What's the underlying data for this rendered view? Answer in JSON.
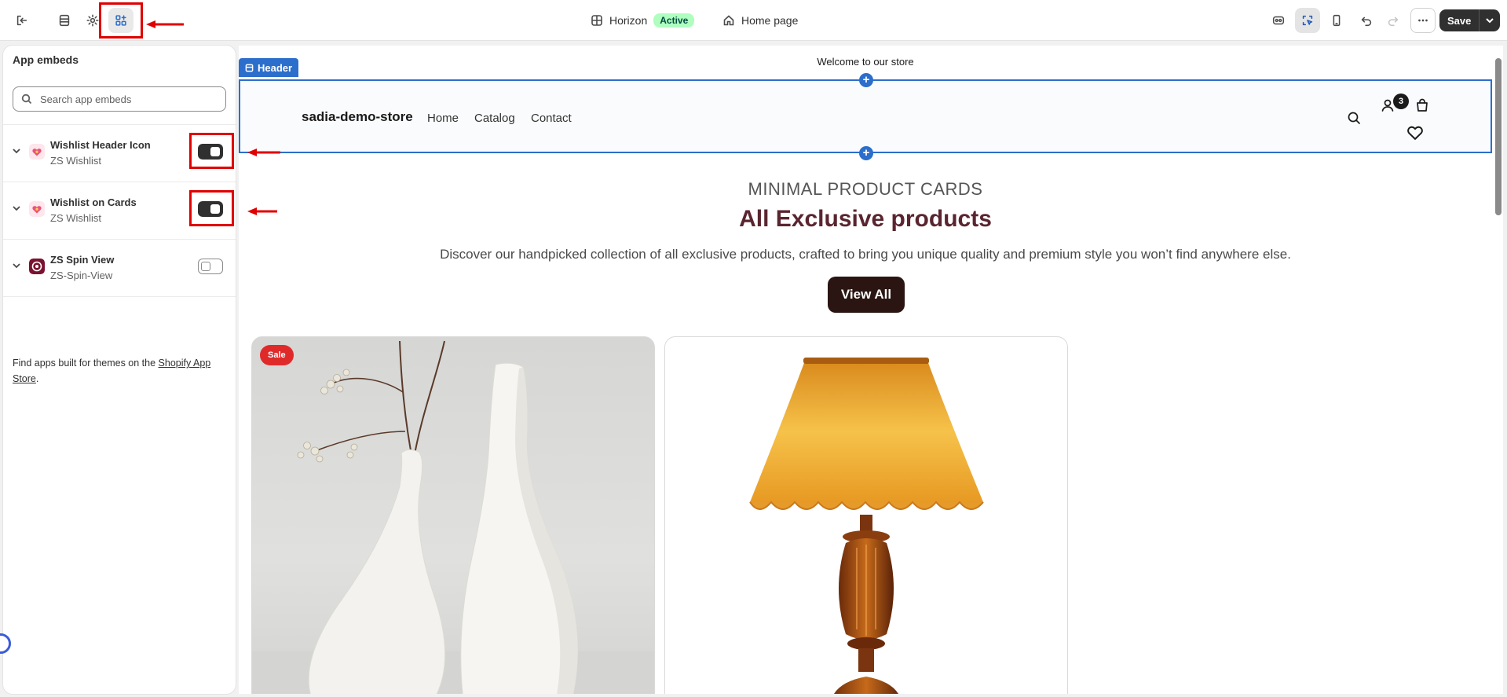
{
  "topbar": {
    "exit_icon": "exit-icon",
    "sections_icon": "sections-icon",
    "settings_icon": "gear-icon",
    "app_embeds_icon": "apps-icon",
    "theme_name": "Horizon",
    "theme_status": "Active",
    "page_name": "Home page",
    "save_label": "Save"
  },
  "panel": {
    "title": "App embeds",
    "search_placeholder": "Search app embeds",
    "embeds": [
      {
        "name": "Wishlist Header Icon",
        "vendor": "ZS Wishlist",
        "enabled": true
      },
      {
        "name": "Wishlist on Cards",
        "vendor": "ZS Wishlist",
        "enabled": true
      },
      {
        "name": "ZS Spin View",
        "vendor": "ZS-Spin-View",
        "enabled": false
      }
    ],
    "footer_prefix": "Find apps built for themes on the ",
    "footer_link": "Shopify App Store",
    "footer_suffix": "."
  },
  "preview": {
    "announcement": "Welcome to our store",
    "header_tag": "Header",
    "store_name": "sadia-demo-store",
    "nav": [
      "Home",
      "Catalog",
      "Contact"
    ],
    "cart_count": "3",
    "eyebrow": "MINIMAL PRODUCT CARDS",
    "title": "All Exclusive products",
    "description": "Discover our handpicked collection of all exclusive products, crafted to bring you unique quality and premium style you won’t find anywhere else.",
    "button_label": "View All",
    "sale_badge": "Sale"
  },
  "colors": {
    "accent_blue": "#2c6ecb",
    "active_badge": "#affebf",
    "title_maroon": "#5a2530",
    "button_dark": "#2a1512",
    "annotation_red": "#e00000"
  }
}
